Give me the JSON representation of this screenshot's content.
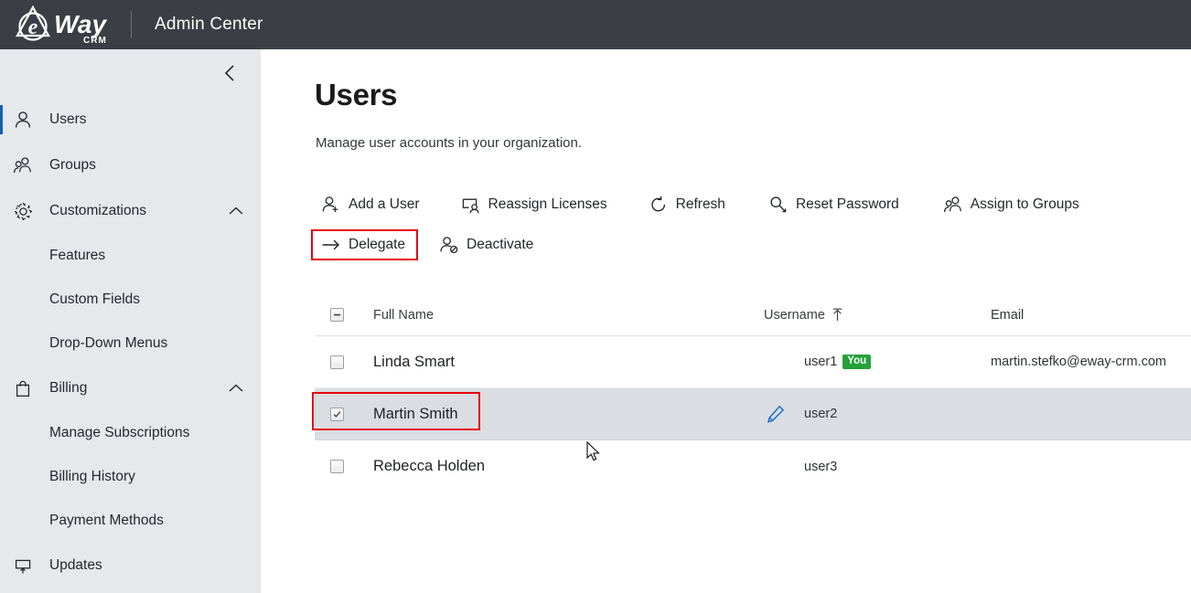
{
  "topbar": {
    "logo_word": "Way",
    "logo_sub": "CRM",
    "logo_letter": "e",
    "app_title": "Admin Center"
  },
  "sidebar": {
    "collapse_icon": "chevron-left-icon",
    "items": [
      {
        "label": "Users",
        "icon": "person-icon",
        "type": "item",
        "active": true,
        "expand": ""
      },
      {
        "label": "Groups",
        "icon": "people-icon",
        "type": "item",
        "active": false,
        "expand": ""
      },
      {
        "label": "Customizations",
        "icon": "gear-icon",
        "type": "item",
        "active": false,
        "expand": "chevron-up-icon"
      },
      {
        "label": "Features",
        "icon": "",
        "type": "sub",
        "active": false,
        "expand": ""
      },
      {
        "label": "Custom Fields",
        "icon": "",
        "type": "sub",
        "active": false,
        "expand": ""
      },
      {
        "label": "Drop-Down Menus",
        "icon": "",
        "type": "sub",
        "active": false,
        "expand": ""
      },
      {
        "label": "Billing",
        "icon": "bag-icon",
        "type": "item",
        "active": false,
        "expand": "chevron-up-icon"
      },
      {
        "label": "Manage Subscriptions",
        "icon": "",
        "type": "sub",
        "active": false,
        "expand": ""
      },
      {
        "label": "Billing History",
        "icon": "",
        "type": "sub",
        "active": false,
        "expand": ""
      },
      {
        "label": "Payment Methods",
        "icon": "",
        "type": "sub",
        "active": false,
        "expand": ""
      },
      {
        "label": "Updates",
        "icon": "monitor-up-icon",
        "type": "item",
        "active": false,
        "expand": ""
      }
    ]
  },
  "main": {
    "title": "Users",
    "subtitle": "Manage user accounts in your organization.",
    "toolbar": {
      "row1": [
        {
          "label": "Add a User",
          "icon": "person-add-icon"
        },
        {
          "label": "Reassign Licenses",
          "icon": "reassign-license-icon"
        },
        {
          "label": "Refresh",
          "icon": "refresh-icon"
        },
        {
          "label": "Reset Password",
          "icon": "key-icon"
        },
        {
          "label": "Assign to Groups",
          "icon": "people-icon"
        }
      ],
      "row2": [
        {
          "label": "Delegate",
          "icon": "arrow-right-icon",
          "highlighted": true
        },
        {
          "label": "Deactivate",
          "icon": "person-block-icon",
          "highlighted": false
        }
      ]
    },
    "table": {
      "columns": {
        "full_name": "Full Name",
        "username": "Username",
        "email": "Email"
      },
      "sort": {
        "column": "Username",
        "direction": "ascending",
        "icon": "arrow-up-icon"
      },
      "select_all_state": "indeterminate",
      "rows": [
        {
          "full_name": "Linda Smart",
          "username": "user1",
          "badge": "You",
          "email": "martin.stefko@eway-crm.com",
          "checked": false,
          "selected": false,
          "edit_icon": false
        },
        {
          "full_name": "Martin Smith",
          "username": "user2",
          "badge": "",
          "email": "",
          "checked": true,
          "selected": true,
          "edit_icon": true
        },
        {
          "full_name": "Rebecca Holden",
          "username": "user3",
          "badge": "",
          "email": "",
          "checked": false,
          "selected": false,
          "edit_icon": false
        }
      ]
    }
  },
  "colors": {
    "topbar_bg": "#3b3f45",
    "sidebar_bg": "#e6e8eb",
    "accent_blue": "#0f63b5",
    "highlight_red": "#e8000d",
    "badge_green": "#25a13a",
    "selected_row": "#dadde1"
  }
}
